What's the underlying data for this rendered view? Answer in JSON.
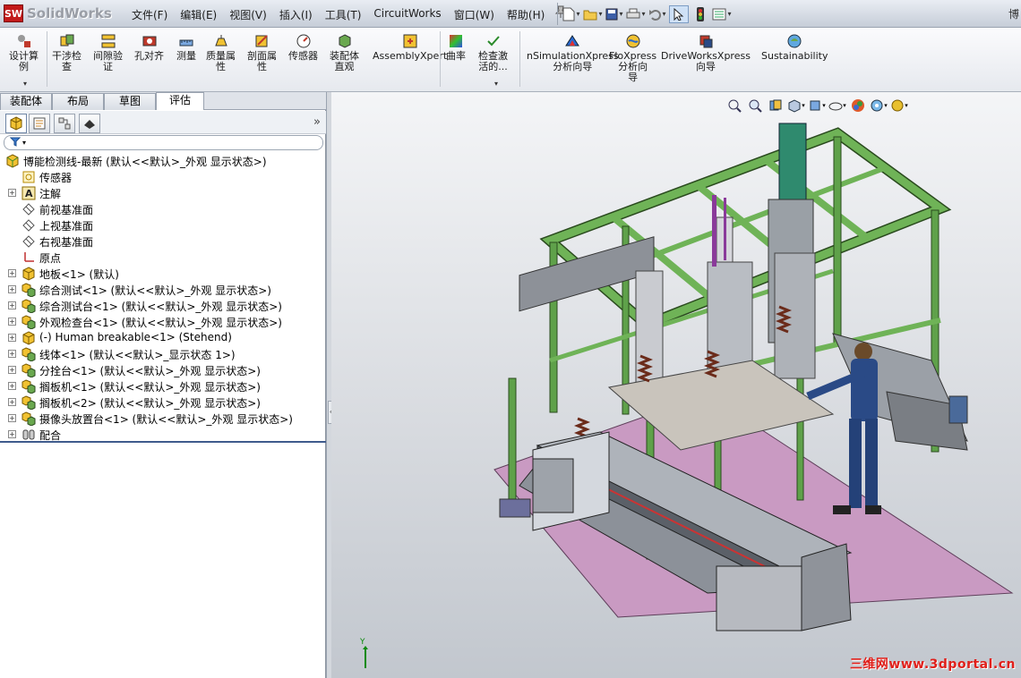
{
  "app": {
    "logo_mark": "SW",
    "logo_text": "SolidWorks",
    "title_fragment": "博"
  },
  "menu": [
    "文件(F)",
    "编辑(E)",
    "视图(V)",
    "插入(I)",
    "工具(T)",
    "CircuitWorks",
    "窗口(W)",
    "帮助(H)"
  ],
  "command_manager": [
    {
      "label": "设计算\n例",
      "icon": "design-study-icon"
    },
    {
      "label": "干涉检\n查",
      "icon": "interference-icon"
    },
    {
      "label": "间隙验\n证",
      "icon": "clearance-icon"
    },
    {
      "label": "孔对齐",
      "icon": "hole-align-icon"
    },
    {
      "label": "测量",
      "icon": "measure-icon"
    },
    {
      "label": "质量属\n性",
      "icon": "mass-props-icon"
    },
    {
      "label": "剖面属\n性",
      "icon": "section-props-icon"
    },
    {
      "label": "传感器",
      "icon": "sensor-icon"
    },
    {
      "label": "装配体\n直观",
      "icon": "assembly-visual-icon"
    },
    {
      "label": "AssemblyXpert",
      "icon": "assemblyxpert-icon"
    },
    {
      "label": "曲率",
      "icon": "curvature-icon"
    },
    {
      "label": "检查激\n活的...",
      "icon": "check-active-icon"
    },
    {
      "label": "nSimulationXpress\n分析向导",
      "icon": "simulation-icon"
    },
    {
      "label": "FloXpress\n分析向\n导",
      "icon": "floxpress-icon"
    },
    {
      "label": "DriveWorksXpress\n向导",
      "icon": "driveworks-icon"
    },
    {
      "label": "Sustainability",
      "icon": "sustainability-icon"
    }
  ],
  "panel_tabs": [
    "装配体",
    "布局",
    "草图",
    "评估"
  ],
  "active_panel_tab": "评估",
  "tree": {
    "root": "博能检测线-最新  (默认<<默认>_外观 显示状态>)",
    "items": [
      {
        "label": "传感器",
        "icon": "sensor-folder-icon",
        "expand": false
      },
      {
        "label": "注解",
        "icon": "annotation-icon",
        "expand": true
      },
      {
        "label": "前视基准面",
        "icon": "plane-icon",
        "expand": false
      },
      {
        "label": "上视基准面",
        "icon": "plane-icon",
        "expand": false
      },
      {
        "label": "右视基准面",
        "icon": "plane-icon",
        "expand": false
      },
      {
        "label": "原点",
        "icon": "origin-icon",
        "expand": false
      },
      {
        "label": "地板<1> (默认)",
        "icon": "part-icon",
        "expand": true
      },
      {
        "label": "综合测试<1> (默认<<默认>_外观 显示状态>)",
        "icon": "subassembly-icon",
        "expand": true
      },
      {
        "label": "综合测试台<1> (默认<<默认>_外观 显示状态>)",
        "icon": "subassembly-icon",
        "expand": true
      },
      {
        "label": "外观检查台<1> (默认<<默认>_外观 显示状态>)",
        "icon": "subassembly-icon",
        "expand": true
      },
      {
        "label": "(-) Human breakable<1> (Stehend)",
        "icon": "part-icon",
        "expand": true
      },
      {
        "label": "线体<1> (默认<<默认>_显示状态 1>)",
        "icon": "subassembly-icon",
        "expand": true
      },
      {
        "label": "分拴台<1> (默认<<默认>_外观 显示状态>)",
        "icon": "subassembly-icon",
        "expand": true
      },
      {
        "label": "搁板机<1> (默认<<默认>_外观 显示状态>)",
        "icon": "subassembly-icon",
        "expand": true
      },
      {
        "label": "搁板机<2> (默认<<默认>_外观 显示状态>)",
        "icon": "subassembly-icon",
        "expand": true
      },
      {
        "label": "摄像头放置台<1> (默认<<默认>_外观 显示状态>)",
        "icon": "subassembly-icon",
        "expand": true
      },
      {
        "label": "配合",
        "icon": "mates-icon",
        "expand": true
      }
    ]
  },
  "triad": {
    "y_label": "Y"
  },
  "watermark": "三维网www.3dportal.cn",
  "colors": {
    "frame_green": "#5fa14a",
    "floor_pink": "#c99ac2",
    "accent_blue": "#3f5b8c"
  }
}
